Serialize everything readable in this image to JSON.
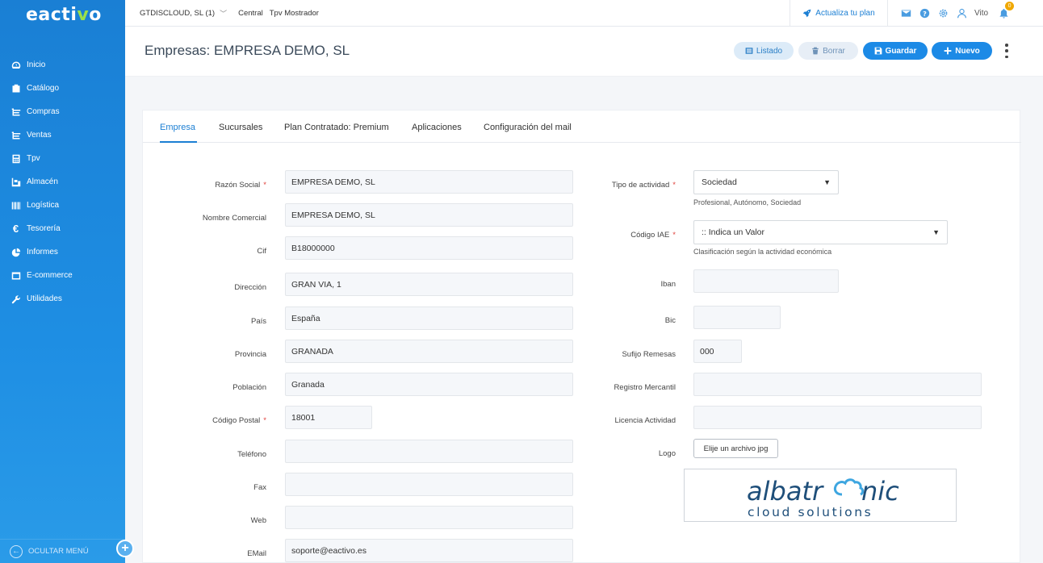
{
  "app": {
    "logo_prefix": "eacti",
    "logo_v": "v",
    "logo_suffix": "o"
  },
  "sidebar": {
    "items": [
      {
        "label": "Inicio",
        "icon": "dashboard-icon"
      },
      {
        "label": "Catálogo",
        "icon": "catalog-icon"
      },
      {
        "label": "Compras",
        "icon": "purchases-icon"
      },
      {
        "label": "Ventas",
        "icon": "sales-icon"
      },
      {
        "label": "Tpv",
        "icon": "pos-icon"
      },
      {
        "label": "Almacén",
        "icon": "warehouse-icon"
      },
      {
        "label": "Logística",
        "icon": "barcode-icon"
      },
      {
        "label": "Tesorería",
        "icon": "euro-icon"
      },
      {
        "label": "Informes",
        "icon": "pie-chart-icon"
      },
      {
        "label": "E-commerce",
        "icon": "browser-icon"
      },
      {
        "label": "Utilidades",
        "icon": "wrench-icon"
      }
    ],
    "footer_label": "OCULTAR MENÚ"
  },
  "topbar": {
    "company": "GTDISCLOUD, SL (1)",
    "crumb1": "Central",
    "crumb2": "Tpv Mostrador",
    "upgrade_label": "Actualiza tu plan",
    "user": "Vito",
    "notifications": "0"
  },
  "header": {
    "title": "Empresas: EMPRESA DEMO, SL",
    "buttons": {
      "list": "Listado",
      "delete": "Borrar",
      "save": "Guardar",
      "new": "Nuevo"
    }
  },
  "tabs": [
    "Empresa",
    "Sucursales",
    "Plan Contratado: Premium",
    "Aplicaciones",
    "Configuración del mail"
  ],
  "form": {
    "left": {
      "razon_social": {
        "label": "Razón Social",
        "value": "EMPRESA DEMO, SL"
      },
      "nombre_comercial": {
        "label": "Nombre Comercial",
        "value": "EMPRESA DEMO, SL"
      },
      "cif": {
        "label": "Cif",
        "value": "B18000000"
      },
      "direccion": {
        "label": "Dirección",
        "value": "GRAN VIA, 1"
      },
      "pais": {
        "label": "País",
        "value": "España"
      },
      "provincia": {
        "label": "Provincia",
        "value": "GRANADA"
      },
      "poblacion": {
        "label": "Población",
        "value": "Granada"
      },
      "codigo_postal": {
        "label": "Código Postal",
        "value": "18001"
      },
      "telefono": {
        "label": "Teléfono",
        "value": ""
      },
      "fax": {
        "label": "Fax",
        "value": ""
      },
      "web": {
        "label": "Web",
        "value": ""
      },
      "email": {
        "label": "EMail",
        "value": "soporte@eactivo.es"
      }
    },
    "right": {
      "tipo_actividad": {
        "label": "Tipo de actividad",
        "value": "Sociedad",
        "hint": "Profesional, Autónomo, Sociedad"
      },
      "codigo_iae": {
        "label": "Código IAE",
        "value": ":: Indica un Valor",
        "hint": "Clasificación según la actividad económica"
      },
      "iban": {
        "label": "Iban",
        "value": ""
      },
      "bic": {
        "label": "Bic",
        "value": ""
      },
      "sufijo_remesas": {
        "label": "Sufijo Remesas",
        "value": "000"
      },
      "registro_mercantil": {
        "label": "Registro Mercantil",
        "value": ""
      },
      "licencia_actividad": {
        "label": "Licencia Actividad",
        "value": ""
      },
      "logo": {
        "label": "Logo",
        "button": "Elije un archivo jpg",
        "brand_name_a": "albatr",
        "brand_name_b": "nic",
        "brand_tagline": "cloud solutions"
      }
    }
  },
  "colors": {
    "primary": "#1c8ae6",
    "sidebar": "#1e8ee3",
    "accent_green": "#9be04a",
    "brand_navy": "#1f4f7a"
  }
}
